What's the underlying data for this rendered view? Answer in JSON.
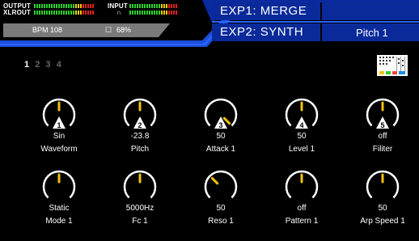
{
  "meters": {
    "output_label": "OUTPUT",
    "xlrout_label": "XLROUT",
    "input_label": "INPUT",
    "headphone_icon": "headphone-icon"
  },
  "status": {
    "bpm": "BPM 108",
    "battery": "68%",
    "battery_icon": "battery-icon"
  },
  "exp1": "EXP1: MERGE",
  "exp2": "EXP2: SYNTH",
  "param_title": "Pitch 1",
  "pages": [
    "1",
    "2",
    "3",
    "4"
  ],
  "active_page": "1",
  "colors": {
    "accent_blue": "#1b4fd8",
    "indicator_yellow": "#f2c200",
    "meter_green": "#2fd02f",
    "meter_red": "#e02020"
  },
  "knobs_row1": [
    {
      "badge": "1",
      "value": "Sin",
      "label": "Waveform",
      "angle": 0
    },
    {
      "badge": "2",
      "value": "-23.8",
      "label": "Pitch",
      "angle": 0
    },
    {
      "badge": "3",
      "value": "50",
      "label": "Attack 1",
      "angle": 135
    },
    {
      "badge": "4",
      "value": "50",
      "label": "Level 1",
      "angle": 0
    },
    {
      "badge": "5",
      "value": "off",
      "label": "Filiter",
      "angle": 0
    }
  ],
  "knobs_row2": [
    {
      "value": "Static",
      "label": "Mode 1",
      "angle": 0
    },
    {
      "value": "5000Hz",
      "label": "Fc 1",
      "angle": 0
    },
    {
      "value": "50",
      "label": "Reso 1",
      "angle": -45
    },
    {
      "value": "off",
      "label": "Pattern 1",
      "angle": 0
    },
    {
      "value": "50",
      "label": "Arp Speed 1",
      "angle": 0
    }
  ]
}
